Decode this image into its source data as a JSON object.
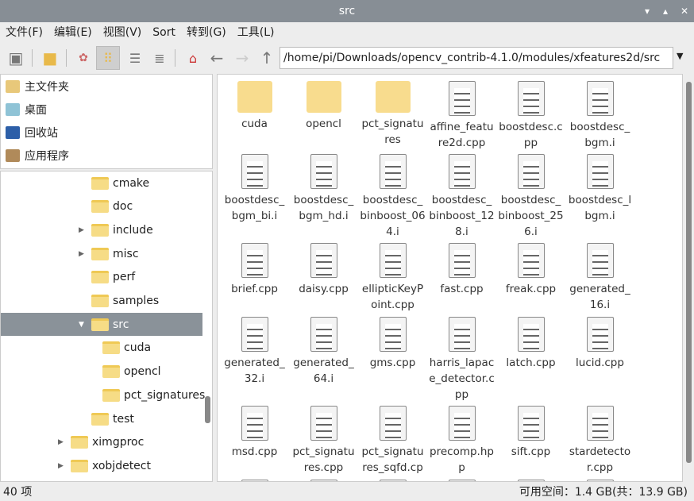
{
  "window": {
    "title": "src"
  },
  "menu": [
    "文件(F)",
    "编辑(E)",
    "视图(V)",
    "Sort",
    "转到(G)",
    "工具(L)"
  ],
  "toolbar": {
    "path": "/home/pi/Downloads/opencv_contrib-4.1.0/modules/xfeatures2d/src",
    "active_view": "icon-view"
  },
  "places": [
    {
      "label": "主文件夹",
      "icon": "home-icon",
      "color": "#e8c87a"
    },
    {
      "label": "桌面",
      "icon": "desktop-icon",
      "color": "#8fc3d6"
    },
    {
      "label": "回收站",
      "icon": "trash-icon",
      "color": "#2d5fa8"
    },
    {
      "label": "应用程序",
      "icon": "applications-icon",
      "color": "#b08a5a"
    }
  ],
  "tree": [
    {
      "label": "cmake",
      "level": 1,
      "expander": ""
    },
    {
      "label": "doc",
      "level": 1,
      "expander": ""
    },
    {
      "label": "include",
      "level": 1,
      "expander": "▶"
    },
    {
      "label": "misc",
      "level": 1,
      "expander": "▶"
    },
    {
      "label": "perf",
      "level": 1,
      "expander": ""
    },
    {
      "label": "samples",
      "level": 1,
      "expander": ""
    },
    {
      "label": "src",
      "level": 1,
      "expander": "▼",
      "selected": true
    },
    {
      "label": "cuda",
      "level": 2,
      "expander": ""
    },
    {
      "label": "opencl",
      "level": 2,
      "expander": ""
    },
    {
      "label": "pct_signatures",
      "level": 2,
      "expander": ""
    },
    {
      "label": "test",
      "level": 1,
      "expander": ""
    },
    {
      "label": "ximgproc",
      "level": 0,
      "expander": "▶"
    },
    {
      "label": "xobjdetect",
      "level": 0,
      "expander": "▶"
    }
  ],
  "files": [
    {
      "name": "cuda",
      "type": "folder"
    },
    {
      "name": "opencl",
      "type": "folder"
    },
    {
      "name": "pct_signatures",
      "type": "folder"
    },
    {
      "name": "affine_feature2d.cpp",
      "type": "file"
    },
    {
      "name": "boostdesc.cpp",
      "type": "file"
    },
    {
      "name": "boostdesc_bgm.i",
      "type": "file"
    },
    {
      "name": "boostdesc_bgm_bi.i",
      "type": "file"
    },
    {
      "name": "boostdesc_bgm_hd.i",
      "type": "file"
    },
    {
      "name": "boostdesc_binboost_064.i",
      "type": "file"
    },
    {
      "name": "boostdesc_binboost_128.i",
      "type": "file"
    },
    {
      "name": "boostdesc_binboost_256.i",
      "type": "file"
    },
    {
      "name": "boostdesc_lbgm.i",
      "type": "file"
    },
    {
      "name": "brief.cpp",
      "type": "file"
    },
    {
      "name": "daisy.cpp",
      "type": "file"
    },
    {
      "name": "ellipticKeyPoint.cpp",
      "type": "file"
    },
    {
      "name": "fast.cpp",
      "type": "file"
    },
    {
      "name": "freak.cpp",
      "type": "file"
    },
    {
      "name": "generated_16.i",
      "type": "file"
    },
    {
      "name": "generated_32.i",
      "type": "file"
    },
    {
      "name": "generated_64.i",
      "type": "file"
    },
    {
      "name": "gms.cpp",
      "type": "file"
    },
    {
      "name": "harris_lapace_detector.cpp",
      "type": "file"
    },
    {
      "name": "latch.cpp",
      "type": "file"
    },
    {
      "name": "lucid.cpp",
      "type": "file"
    },
    {
      "name": "msd.cpp",
      "type": "file"
    },
    {
      "name": "pct_signatures.cpp",
      "type": "file"
    },
    {
      "name": "pct_signatures_sqfd.cpp",
      "type": "file"
    },
    {
      "name": "precomp.hpp",
      "type": "file"
    },
    {
      "name": "sift.cpp",
      "type": "file"
    },
    {
      "name": "stardetector.cpp",
      "type": "file"
    }
  ],
  "status": {
    "count": "40 项",
    "free": "可用空间：1.4 GB(共：13.9 GB)"
  }
}
